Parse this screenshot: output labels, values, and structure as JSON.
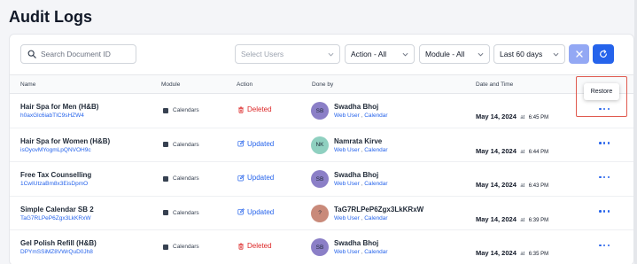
{
  "page": {
    "title": "Audit Logs"
  },
  "filters": {
    "search_placeholder": "Search Document ID",
    "users_placeholder": "Select Users",
    "action_value": "Action - All",
    "module_value": "Module - All",
    "range_value": "Last 60 days",
    "clear_icon": "close-icon",
    "refresh_icon": "refresh-icon"
  },
  "table": {
    "columns": {
      "name": "Name",
      "module": "Module",
      "action": "Action",
      "done_by": "Done by",
      "date_time": "Date and Time"
    },
    "rows": [
      {
        "name": "Hair Spa for Men (H&B)",
        "doc_id": "h0axGlc6iabTIC9sHZW4",
        "module": "Calendars",
        "action": "Deleted",
        "action_type": "deleted",
        "initials": "SB",
        "avatar_color": "#8b7fc7",
        "user": "Swadha Bhoj",
        "role": "Web User",
        "user_module": "Calendar",
        "date": "May 14, 2024",
        "at": "at",
        "time": "6:45 PM"
      },
      {
        "name": "Hair Spa for Women (H&B)",
        "doc_id": "isOyovMYogmLpQNVOH9c",
        "module": "Calendars",
        "action": "Updated",
        "action_type": "updated",
        "initials": "NK",
        "avatar_color": "#8fd0c0",
        "user": "Namrata Kirve",
        "role": "Web User",
        "user_module": "Calendar",
        "date": "May 14, 2024",
        "at": "at",
        "time": "6:44 PM"
      },
      {
        "name": "Free Tax Counselling",
        "doc_id": "1CwIUtzaBm8x3EisDpmO",
        "module": "Calendars",
        "action": "Updated",
        "action_type": "updated",
        "initials": "SB",
        "avatar_color": "#8b7fc7",
        "user": "Swadha Bhoj",
        "role": "Web User",
        "user_module": "Calendar",
        "date": "May 14, 2024",
        "at": "at",
        "time": "6:43 PM"
      },
      {
        "name": "Simple Calendar SB 2",
        "doc_id": "TaG7RLPeP6Zgx3LkKRxW",
        "module": "Calendars",
        "action": "Updated",
        "action_type": "updated",
        "initials": "?",
        "avatar_color": "#c98a7a",
        "user": "TaG7RLPeP6Zgx3LkKRxW",
        "role": "Web User",
        "user_module": "Calendar",
        "date": "May 14, 2024",
        "at": "at",
        "time": "6:39 PM"
      },
      {
        "name": "Gel Polish Refill (H&B)",
        "doc_id": "DPYmSSiMZ8VWrQuD0Jh8",
        "module": "Calendars",
        "action": "Deleted",
        "action_type": "deleted",
        "initials": "SB",
        "avatar_color": "#8b7fc7",
        "user": "Swadha Bhoj",
        "role": "Web User",
        "user_module": "Calendar",
        "date": "May 14, 2024",
        "at": "at",
        "time": "6:35 PM"
      }
    ]
  },
  "tooltip": {
    "label": "Restore"
  },
  "colors": {
    "primary": "#2563eb",
    "danger": "#dc2626",
    "highlight": "#e05a4f"
  }
}
